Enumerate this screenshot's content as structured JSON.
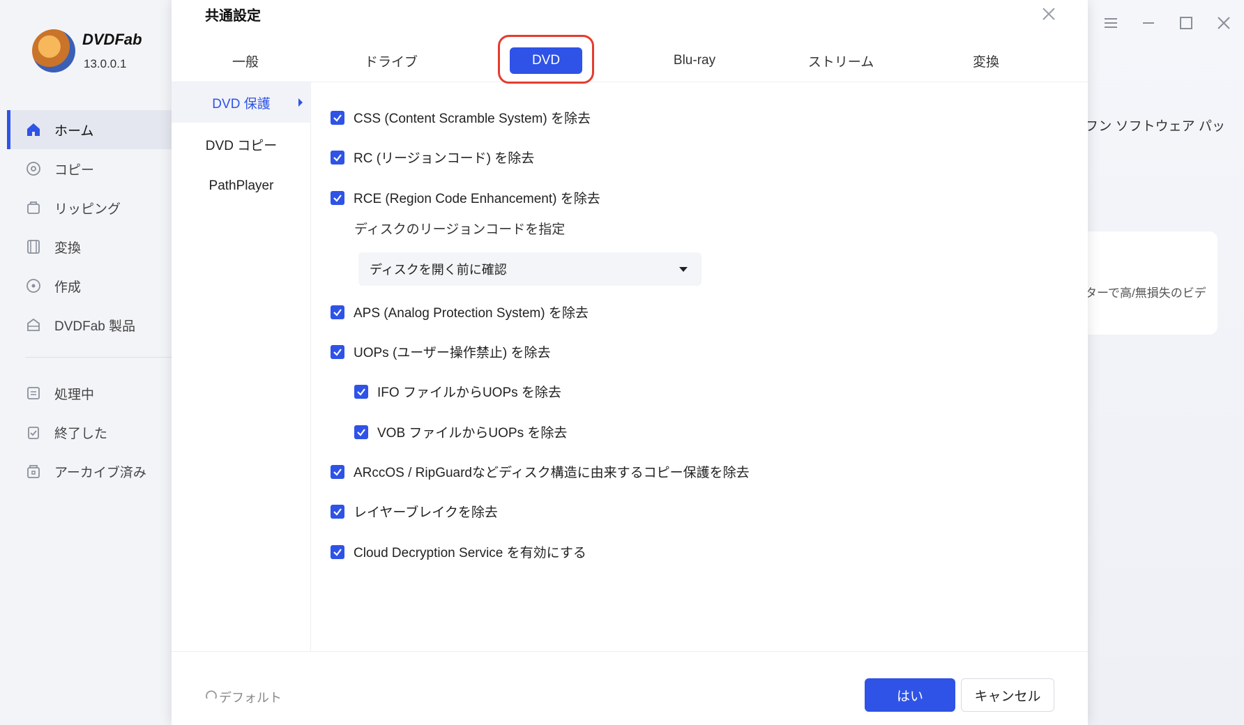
{
  "app": {
    "brand": "DVDFab",
    "version": "13.0.0.1",
    "nav": [
      {
        "label": "ホーム"
      },
      {
        "label": "コピー"
      },
      {
        "label": "リッピング"
      },
      {
        "label": "変換"
      },
      {
        "label": "作成"
      },
      {
        "label": "DVDFab 製品"
      },
      {
        "label": "処理中"
      },
      {
        "label": "終了した"
      },
      {
        "label": "アーカイブ済み"
      }
    ],
    "background_text_1": "フン ソフトウェア パッ",
    "background_text_2": "ターで高/無損失のビデ"
  },
  "dialog": {
    "title": "共通設定",
    "tabs": [
      {
        "label": "一般"
      },
      {
        "label": "ドライブ"
      },
      {
        "label": "DVD"
      },
      {
        "label": "Blu-ray"
      },
      {
        "label": "ストリーム"
      },
      {
        "label": "変換"
      }
    ],
    "active_tab": "DVD",
    "subnav": [
      {
        "label": "DVD 保護"
      },
      {
        "label": "DVD コピー"
      },
      {
        "label": "PathPlayer"
      }
    ],
    "options": [
      {
        "label": "CSS (Content Scramble System) を除去",
        "checked": true
      },
      {
        "label": "RC (リージョンコード) を除去",
        "checked": true
      },
      {
        "label": "RCE (Region Code Enhancement) を除去",
        "checked": true
      },
      {
        "label": "APS (Analog Protection System) を除去",
        "checked": true
      },
      {
        "label": "UOPs (ユーザー操作禁止) を除去",
        "checked": true
      },
      {
        "label": "IFO ファイルからUOPs を除去",
        "checked": true
      },
      {
        "label": "VOB ファイルからUOPs を除去",
        "checked": true
      },
      {
        "label": "ARccOS / RipGuardなどディスク構造に由来するコピー保護を除去",
        "checked": true
      },
      {
        "label": "レイヤーブレイクを除去",
        "checked": true
      },
      {
        "label": "Cloud Decryption Service を有効にする",
        "checked": true
      }
    ],
    "region_label": "ディスクのリージョンコードを指定",
    "region_dropdown_value": "ディスクを開く前に確認",
    "footer": {
      "default_label": "デフォルト",
      "ok_label": "はい",
      "cancel_label": "キャンセル"
    }
  },
  "colors": {
    "accent": "#2f53e6",
    "highlight": "#e53b2e"
  }
}
